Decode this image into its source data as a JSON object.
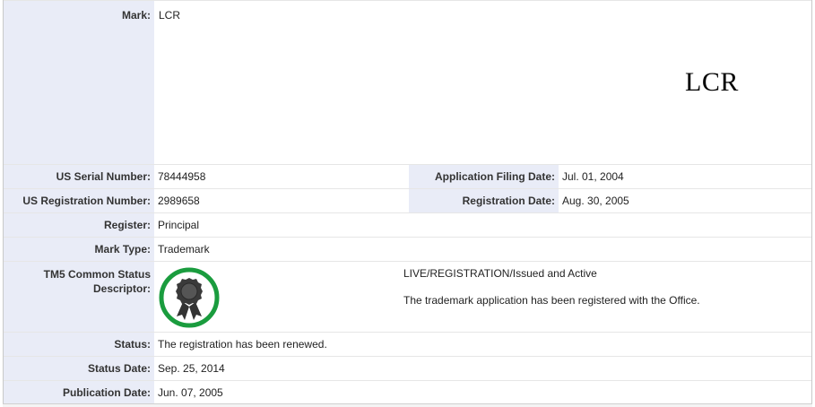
{
  "mark": {
    "label": "Mark:",
    "value": "LCR",
    "image_text": "LCR"
  },
  "serial": {
    "label": "US Serial Number:",
    "value": "78444958",
    "filing_label": "Application Filing Date:",
    "filing_value": "Jul. 01, 2004"
  },
  "registration": {
    "label": "US Registration Number:",
    "value": "2989658",
    "date_label": "Registration Date:",
    "date_value": "Aug. 30, 2005"
  },
  "register": {
    "label": "Register:",
    "value": "Principal"
  },
  "mark_type": {
    "label": "Mark Type:",
    "value": "Trademark"
  },
  "tm5": {
    "label_line1": "TM5 Common Status",
    "label_line2": "Descriptor:",
    "icon": "registered-ribbon-icon",
    "ring_color": "#1a9c3e",
    "status": "LIVE/REGISTRATION/Issued and Active",
    "description": "The trademark application has been registered with the Office."
  },
  "status": {
    "label": "Status:",
    "value": "The registration has been renewed."
  },
  "status_date": {
    "label": "Status Date:",
    "value": "Sep. 25, 2014"
  },
  "publication_date": {
    "label": "Publication Date:",
    "value": "Jun. 07, 2005"
  }
}
